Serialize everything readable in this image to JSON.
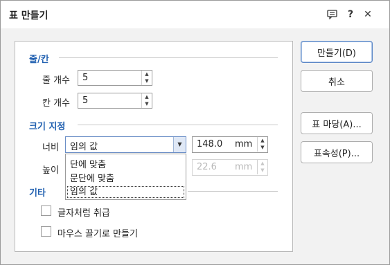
{
  "window": {
    "title": "표 만들기",
    "help_label": "?",
    "close_label": "✕"
  },
  "sections": {
    "rows_cols": "줄/칸",
    "size": "크기 지정",
    "other": "기타"
  },
  "rows": {
    "label": "줄 개수",
    "value": "5"
  },
  "cols": {
    "label": "칸 개수",
    "value": "5"
  },
  "width": {
    "label": "너비",
    "mode": "임의 값",
    "value": "148.0",
    "unit": "mm",
    "options": [
      "단에 맞춤",
      "문단에 맞춤",
      "임의 값"
    ]
  },
  "height": {
    "label": "높이",
    "value": "22.6",
    "unit": "mm"
  },
  "options": {
    "treat_as_char": "글자처럼 취급",
    "mouse_drag_create": "마우스 끌기로 만들기"
  },
  "buttons": {
    "create": "만들기(D)",
    "cancel": "취소",
    "table_template": "표 마당(A)...",
    "table_properties": "표속성(P)..."
  }
}
